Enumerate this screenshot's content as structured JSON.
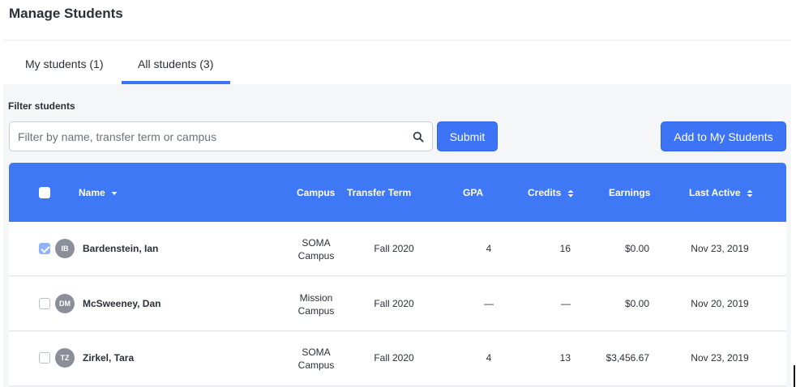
{
  "page": {
    "title": "Manage Students"
  },
  "tabs": [
    {
      "label": "My students (1)",
      "active": false
    },
    {
      "label": "All students (3)",
      "active": true
    }
  ],
  "filter": {
    "label": "Filter students",
    "placeholder": "Filter by name, transfer term or campus",
    "value": "",
    "submit_label": "Submit",
    "add_label": "Add to My Students"
  },
  "table": {
    "headers": {
      "name": "Name",
      "campus": "Campus",
      "transfer_term": "Transfer Term",
      "gpa": "GPA",
      "credits": "Credits",
      "earnings": "Earnings",
      "last_active": "Last Active"
    },
    "rows": [
      {
        "checked": true,
        "initials": "IB",
        "name": "Bardenstein, Ian",
        "campus_line1": "SOMA",
        "campus_line2": "Campus",
        "term": "Fall 2020",
        "gpa": "4",
        "credits": "16",
        "earnings": "$0.00",
        "last_active": "Nov 23, 2019"
      },
      {
        "checked": false,
        "initials": "DM",
        "name": "McSweeney, Dan",
        "campus_line1": "Mission",
        "campus_line2": "Campus",
        "term": "Fall 2020",
        "gpa": "—",
        "credits": "—",
        "earnings": "$0.00",
        "last_active": "Nov 20, 2019"
      },
      {
        "checked": false,
        "initials": "TZ",
        "name": "Zirkel, Tara",
        "campus_line1": "SOMA",
        "campus_line2": "Campus",
        "term": "Fall 2020",
        "gpa": "4",
        "credits": "13",
        "earnings": "$3,456.67",
        "last_active": "Nov 23, 2019"
      }
    ]
  },
  "colors": {
    "accent": "#3d73f5",
    "header_bg": "#3f78f4",
    "panel_bg": "#f5f6f8",
    "avatar_bg": "#8a8f99"
  }
}
